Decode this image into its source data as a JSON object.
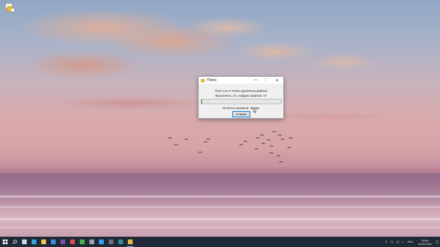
{
  "dialog": {
    "title": "Поиск",
    "stage_text": "Этап 1 из 3: Поиск удалённых файлов",
    "progress_text": "Выполнено: 1%, найдено файлов: 17",
    "progress_value": 0.01,
    "time_left_text": "Осталось времени: 30 мин",
    "cancel_label": "Отмена",
    "minimize_glyph": "—",
    "maximize_glyph": "☐",
    "close_glyph": "✕"
  },
  "taskbar": {
    "start_icon": "windows-logo-icon",
    "search_icon": "search-icon",
    "pinned": [
      {
        "name": "task-view-icon",
        "color": "#cfd8e3"
      },
      {
        "name": "edge-icon",
        "color": "#3aa0d8"
      },
      {
        "name": "file-explorer-icon",
        "color": "#f2c14e"
      },
      {
        "name": "store-icon",
        "color": "#3b8de0"
      },
      {
        "name": "viber-icon",
        "color": "#7b519d"
      },
      {
        "name": "app-icon",
        "color": "#d94f4f"
      },
      {
        "name": "chrome-icon",
        "color": "#4caf50"
      },
      {
        "name": "settings-icon",
        "color": "#9aa4ae"
      },
      {
        "name": "photoshop-icon",
        "color": "#2fa3f7"
      },
      {
        "name": "app-icon-2",
        "color": "#666f7a"
      },
      {
        "name": "terminal-icon",
        "color": "#2d8f8f"
      },
      {
        "name": "recovery-app-icon",
        "color": "#e8b64a"
      }
    ],
    "tray": {
      "language": "РУС",
      "time": "10:00",
      "date": "19.02.2021"
    }
  },
  "colors": {
    "taskbar_bg": "#1f2a36",
    "progress_fill": "#06b025",
    "button_border": "#0078d7"
  }
}
